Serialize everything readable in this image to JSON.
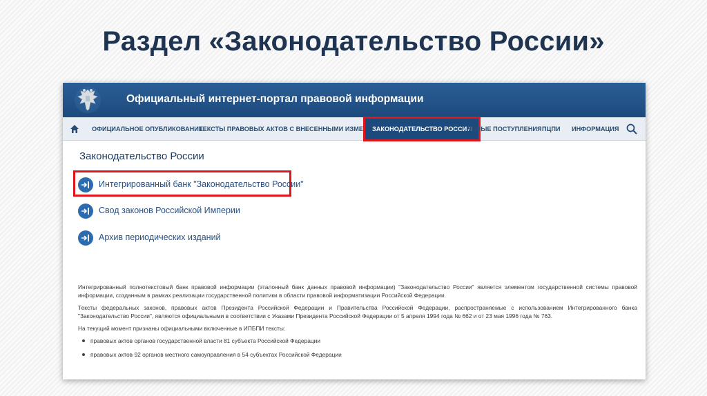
{
  "slide_title": "Раздел «Законодательство России»",
  "portal": {
    "title": "Официальный интернет-портал правовой информации",
    "emblem_icon": "russian-double-headed-eagle"
  },
  "nav": {
    "home_icon": "home-icon",
    "items": [
      {
        "label": "Официальное опубликование",
        "active": false
      },
      {
        "label": "Тексты правовых актов с внесенными изменениями",
        "active": false
      },
      {
        "label": "Законодательство России",
        "active": true
      },
      {
        "label": "Новые поступления",
        "active": false
      },
      {
        "label": "ПЦПИ",
        "active": false
      },
      {
        "label": "Информация",
        "active": false
      }
    ],
    "search_icon": "search-icon"
  },
  "section": {
    "heading": "Законодательство России",
    "links": [
      {
        "label": "Интегрированный банк \"Законодательство России\"",
        "highlighted": true
      },
      {
        "label": "Свод законов Российской Империи",
        "highlighted": false
      },
      {
        "label": "Архив периодических изданий",
        "highlighted": false
      }
    ]
  },
  "info": {
    "p1": "Интегрированный полнотекстовый банк правовой информации (эталонный банк данных правовой информации) \"Законодательство России\" является элементом государственной системы правовой информации, созданным в рамках реализации государственной политики в области правовой информатизации Российской Федерации.",
    "p2": "Тексты федеральных законов, правовых актов Президента Российской Федерации и Правительства Российской Федерации, распространяемые с использованием Интегрированного банка \"Законодательство России\", являются официальными в соответствии с Указами Президента Российской Федерации от 5 апреля 1994 года № 662 и от 23 мая 1996 года № 763.",
    "p3": "На текущий момент признаны официальными включенные в ИПБПИ тексты:",
    "bullets": [
      "правовых актов органов государственной власти 81 субъекта Российской Федерации",
      "правовых актов 92 органов местного самоуправления в 54 субъектах Российской Федерации"
    ]
  },
  "colors": {
    "header_blue": "#1d4a7c",
    "highlight_red": "#e0141b",
    "title_navy": "#1f3450"
  }
}
